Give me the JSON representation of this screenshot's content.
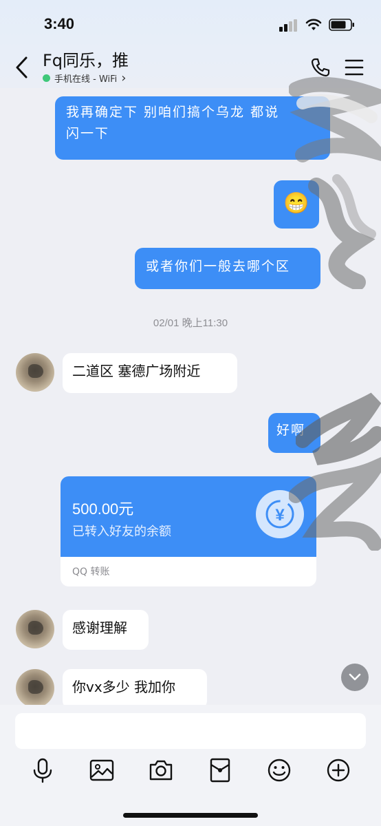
{
  "status_bar": {
    "time": "3:40"
  },
  "header": {
    "title": "Fq同乐，推",
    "status": "手机在线 - WiFi",
    "status_chevron": "›"
  },
  "messages": {
    "out1": "我再确定下 别咱们搞个乌龙 都说\n闪一下",
    "out2_emoji": "😁",
    "out3": "或者你们一般去哪个区",
    "timestamp": "02/01 晚上11:30",
    "in1": "二道区 塞德广场附近",
    "out4": "好啊",
    "in2": "感谢理解",
    "in3": "你vx多少 我加你"
  },
  "transfer": {
    "amount": "500.00元",
    "note": "已转入好友的余额",
    "source": "QQ 转账",
    "icon_symbol": "¥"
  },
  "toolbar": {
    "icons": [
      "microphone-icon",
      "image-icon",
      "camera-icon",
      "red-packet-icon",
      "emoji-icon",
      "plus-icon"
    ]
  },
  "colors": {
    "accent": "#3d8ef6",
    "online": "#3fc87a"
  }
}
